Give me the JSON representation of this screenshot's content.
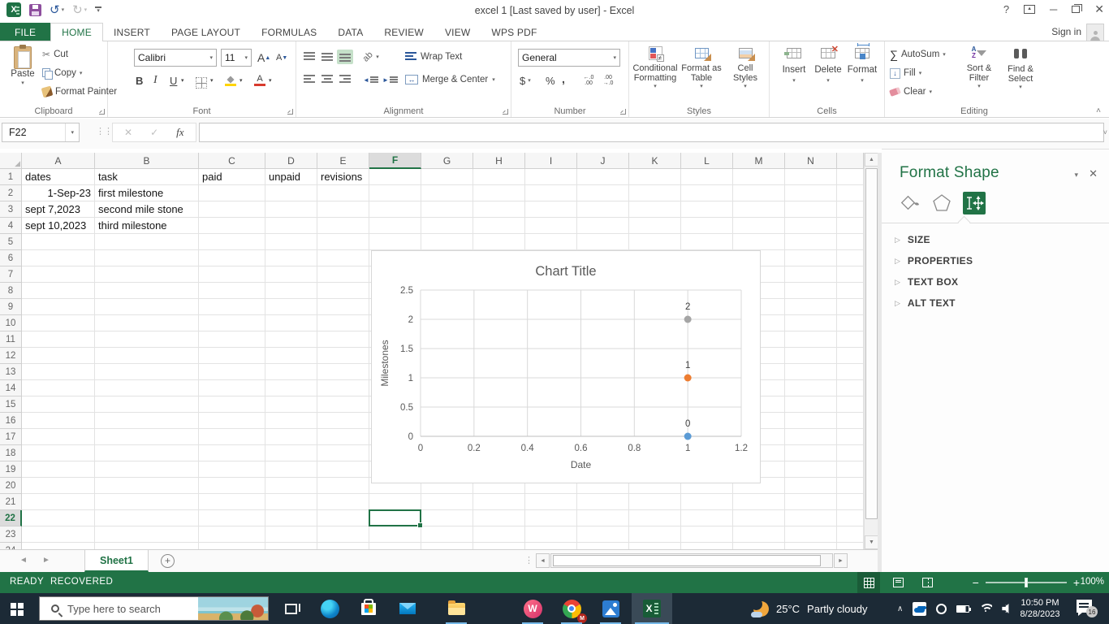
{
  "title_bar": {
    "title": "excel 1 [Last saved by user] - Excel",
    "help": "?"
  },
  "tabs": {
    "items": [
      {
        "label": "FILE"
      },
      {
        "label": "HOME"
      },
      {
        "label": "INSERT"
      },
      {
        "label": "PAGE LAYOUT"
      },
      {
        "label": "FORMULAS"
      },
      {
        "label": "DATA"
      },
      {
        "label": "REVIEW"
      },
      {
        "label": "VIEW"
      },
      {
        "label": "WPS PDF"
      }
    ],
    "sign_in": "Sign in"
  },
  "ribbon": {
    "clipboard": {
      "group": "Clipboard",
      "paste": "Paste",
      "cut": "Cut",
      "copy": "Copy",
      "format_painter": "Format Painter"
    },
    "font": {
      "group": "Font",
      "family": "Calibri",
      "size": "11",
      "bold": "B",
      "italic": "I",
      "underline": "U"
    },
    "alignment": {
      "group": "Alignment",
      "wrap": "Wrap Text",
      "merge": "Merge & Center",
      "orientation": "ab"
    },
    "number": {
      "group": "Number",
      "format": "General",
      "currency": "$",
      "percent": "%",
      "comma": ","
    },
    "styles": {
      "group": "Styles",
      "conditional": "Conditional Formatting",
      "format_table": "Format as Table",
      "cell_styles": "Cell Styles",
      "neq": "≠"
    },
    "cells": {
      "group": "Cells",
      "insert": "Insert",
      "delete": "Delete",
      "format": "Format"
    },
    "editing": {
      "group": "Editing",
      "autosum": "AutoSum",
      "fill": "Fill",
      "clear": "Clear",
      "sort_filter": "Sort & Filter",
      "find_select": "Find & Select"
    }
  },
  "icons": {
    "dropdown": "▾",
    "undo": "↺",
    "redo": "↻",
    "scissors": "✂",
    "sum": "∑",
    "check": "✓",
    "cancel": "✕",
    "fx": "fx",
    "minimize": "─",
    "close": "✕",
    "up_small": "▲",
    "down_small": "▼",
    "left_small": "◄",
    "right_small": "►",
    "grow": "A",
    "shrink": "A",
    "merge_arrows": "↔",
    "fill_down": "↓",
    "inc_decimal": "←.0 .00",
    "dec_decimal": ".00 →.0",
    "sort_a": "A",
    "sort_z": "Z",
    "ellipsis_v": "⋮⋮",
    "select_all": "◢",
    "expander": "▷",
    "pane_min": "▼",
    "chevron_up": "∧",
    "collapse": "˄",
    "formula_expand": "˅",
    "add": "+",
    "ribbon_display_arrow": "▲",
    "speaker_arc": ")",
    "help": "?"
  },
  "formula_bar": {
    "name_box": "F22",
    "formula": ""
  },
  "grid": {
    "columns": [
      "A",
      "B",
      "C",
      "D",
      "E",
      "F",
      "G",
      "H",
      "I",
      "J",
      "K",
      "L",
      "M",
      "N"
    ],
    "selected_column": "F",
    "selected_row": 22,
    "selected_cell": "F22",
    "row_count": 24,
    "rows": [
      {
        "n": 1,
        "cells": [
          {
            "col": "A",
            "value": "dates"
          },
          {
            "col": "B",
            "value": "task"
          },
          {
            "col": "C",
            "value": "paid"
          },
          {
            "col": "D",
            "value": "unpaid"
          },
          {
            "col": "E",
            "value": "revisions"
          }
        ]
      },
      {
        "n": 2,
        "cells": [
          {
            "col": "A",
            "value": "1-Sep-23",
            "align": "right"
          },
          {
            "col": "B",
            "value": "first milestone"
          }
        ]
      },
      {
        "n": 3,
        "cells": [
          {
            "col": "A",
            "value": "sept 7,2023"
          },
          {
            "col": "B",
            "value": "second mile stone"
          }
        ]
      },
      {
        "n": 4,
        "cells": [
          {
            "col": "A",
            "value": "sept 10,2023"
          },
          {
            "col": "B",
            "value": "third milestone"
          }
        ]
      }
    ]
  },
  "chart_data": {
    "type": "scatter",
    "title": "Chart Title",
    "xlabel": "Date",
    "ylabel": "Milestones",
    "xlim": [
      0,
      1.2
    ],
    "ylim": [
      0,
      2.5
    ],
    "xticks": [
      "0",
      "0.2",
      "0.4",
      "0.6",
      "0.8",
      "1",
      "1.2"
    ],
    "yticks": [
      "0",
      "0.5",
      "1",
      "1.5",
      "2",
      "2.5"
    ],
    "grid": true,
    "legend": false,
    "series": [
      {
        "name": "point-blue",
        "color": "#5B9BD5",
        "x": 1,
        "y": 0,
        "label": "0"
      },
      {
        "name": "point-orange",
        "color": "#ED7D31",
        "x": 1,
        "y": 1,
        "label": "1"
      },
      {
        "name": "point-gray",
        "color": "#A5A5A5",
        "x": 1,
        "y": 2,
        "label": "2"
      }
    ]
  },
  "format_pane": {
    "title": "Format Shape",
    "sections": [
      {
        "label": "SIZE"
      },
      {
        "label": "PROPERTIES"
      },
      {
        "label": "TEXT BOX"
      },
      {
        "label": "ALT TEXT"
      }
    ]
  },
  "sheet_bar": {
    "tab": "Sheet1"
  },
  "status_bar": {
    "mode": "READY",
    "recovered": "RECOVERED",
    "zoom_level": "100%"
  },
  "taskbar": {
    "search_placeholder": "Type here to search",
    "weather": {
      "temp": "25°C",
      "condition": "Partly cloudy"
    },
    "clock": {
      "time": "10:50 PM",
      "date": "8/28/2023"
    },
    "notification_count": "16",
    "chrome_badge": "M",
    "wps_letter": "W",
    "excel_letter": "X"
  }
}
